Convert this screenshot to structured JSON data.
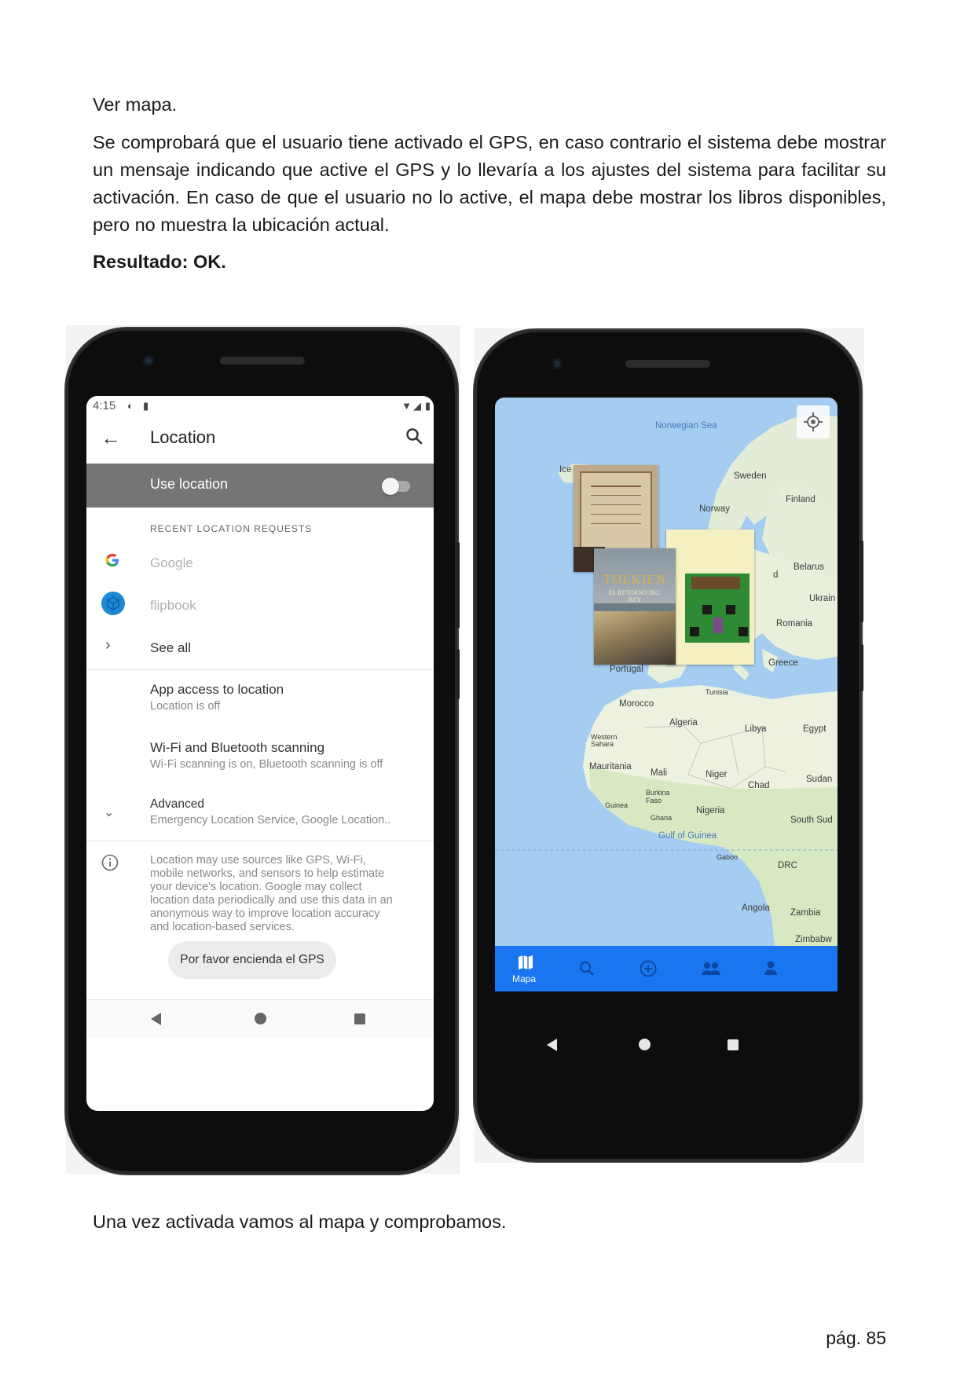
{
  "document": {
    "heading": "Ver mapa.",
    "paragraph": "Se comprobará que el usuario tiene activado el GPS, en caso contrario el sistema debe mostrar un mensaje indicando que active el GPS y lo llevaría a los ajustes del sistema para facilitar su activación. En caso de que el usuario no lo active, el mapa debe mostrar los libros disponibles, pero no muestra la ubicación actual.",
    "result": "Resultado: OK.",
    "caption": "Una vez activada vamos al mapa y comprobamos.",
    "page_number": "pág. 85"
  },
  "settings_screen": {
    "status_time": "4:15",
    "title": "Location",
    "use_location_label": "Use location",
    "use_location_enabled": false,
    "recent_header": "RECENT LOCATION REQUESTS",
    "recent_apps": [
      "Google",
      "flipbook"
    ],
    "see_all": "See all",
    "app_access_title": "App access to location",
    "app_access_sub": "Location is off",
    "scanning_title": "Wi-Fi and Bluetooth scanning",
    "scanning_sub": "Wi-Fi scanning is on, Bluetooth scanning is off",
    "advanced_title": "Advanced",
    "advanced_sub": "Emergency Location Service, Google Location..",
    "info_text": "Location may use sources like GPS, Wi-Fi, mobile networks, and sensors to help estimate your device's location. Google may collect location data periodically and use this data in an anonymous way to improve location accuracy and location-based services.",
    "toast": "Por favor encienda el GPS",
    "icons": [
      "back-arrow-icon",
      "search-icon",
      "google-icon",
      "flipbook-icon",
      "chevron-right-icon",
      "chevron-down-icon",
      "info-icon"
    ]
  },
  "map_screen": {
    "labels": {
      "norwegian_sea": "Norwegian Sea",
      "iceland": "Ice",
      "sweden": "Sweden",
      "finland": "Finland",
      "norway": "Norway",
      "belarus": "Belarus",
      "ukraine": "Ukrain",
      "romania": "Romania",
      "greece": "Greece",
      "portugal": "Portugal",
      "tunisia": "Tunisia",
      "morocco": "Morocco",
      "algeria": "Algeria",
      "libya": "Libya",
      "egypt": "Egypt",
      "western_sahara": "Western Sahara",
      "mauritania": "Mauritania",
      "mali": "Mali",
      "niger": "Niger",
      "chad": "Chad",
      "sudan": "Sudan",
      "burkina_faso": "Burkina Faso",
      "guinea": "Guinea",
      "nigeria": "Nigeria",
      "ghana": "Ghana",
      "south_sudan": "South Sud",
      "gulf_of_guinea": "Gulf of Guinea",
      "gabon": "Gabon",
      "drc": "DRC",
      "angola": "Angola",
      "zambia": "Zambia",
      "zimbabwe": "Zimbabw",
      "d_fragment": "d"
    },
    "book_cover_text": {
      "tolkien": "TOLKIEN",
      "retorno": "EL RETORNO DEL REY"
    },
    "bottom_nav": {
      "active_label": "Mapa",
      "items": [
        "map-icon",
        "search-icon",
        "add-circle-icon",
        "group-icon",
        "person-icon"
      ]
    },
    "colors": {
      "water": "#a5cdf1",
      "land": "#e9f0dc",
      "nav": "#1976f0"
    }
  }
}
